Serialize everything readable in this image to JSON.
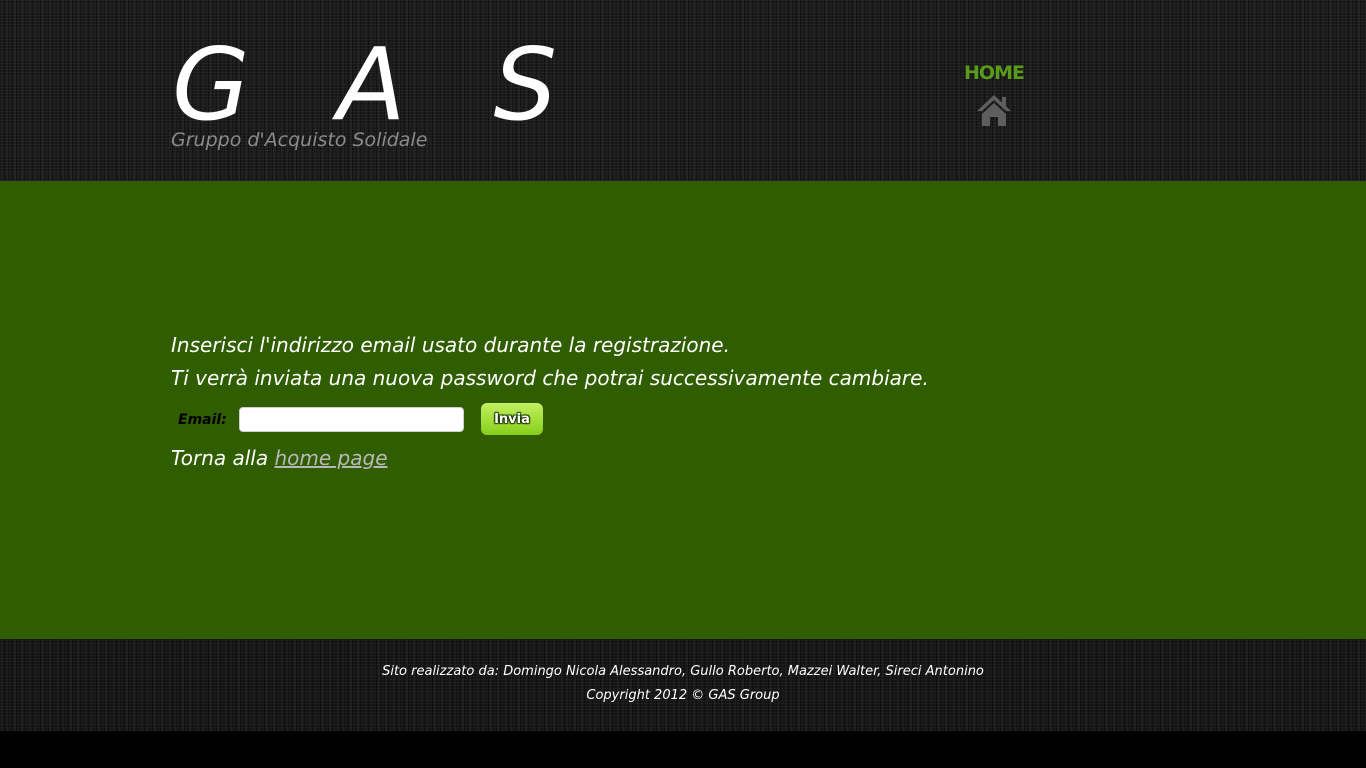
{
  "header": {
    "logo_title": "G A S",
    "logo_subtitle": "Gruppo d'Acquisto Solidale",
    "nav": {
      "home_label": "HOME",
      "home_icon": "home-icon"
    }
  },
  "main": {
    "instruction_line_1": "Inserisci l'indirizzo email usato durante la registrazione.",
    "instruction_line_2": "Ti verrà inviata una nuova password che potrai successivamente cambiare.",
    "form": {
      "email_label": "Email:",
      "email_value": "",
      "submit_label": "Invia"
    },
    "back_prefix": "Torna alla ",
    "back_link": "home page"
  },
  "footer": {
    "credits": "Sito realizzato da: Domingo Nicola Alessandro, Gullo Roberto, Mazzei Walter, Sireci Antonino",
    "copyright": "Copyright 2012 © GAS Group"
  },
  "colors": {
    "main_background": "#305d00",
    "nav_accent": "#5a9a1a",
    "button_top": "#c3f060",
    "button_bottom": "#86cf1a"
  }
}
